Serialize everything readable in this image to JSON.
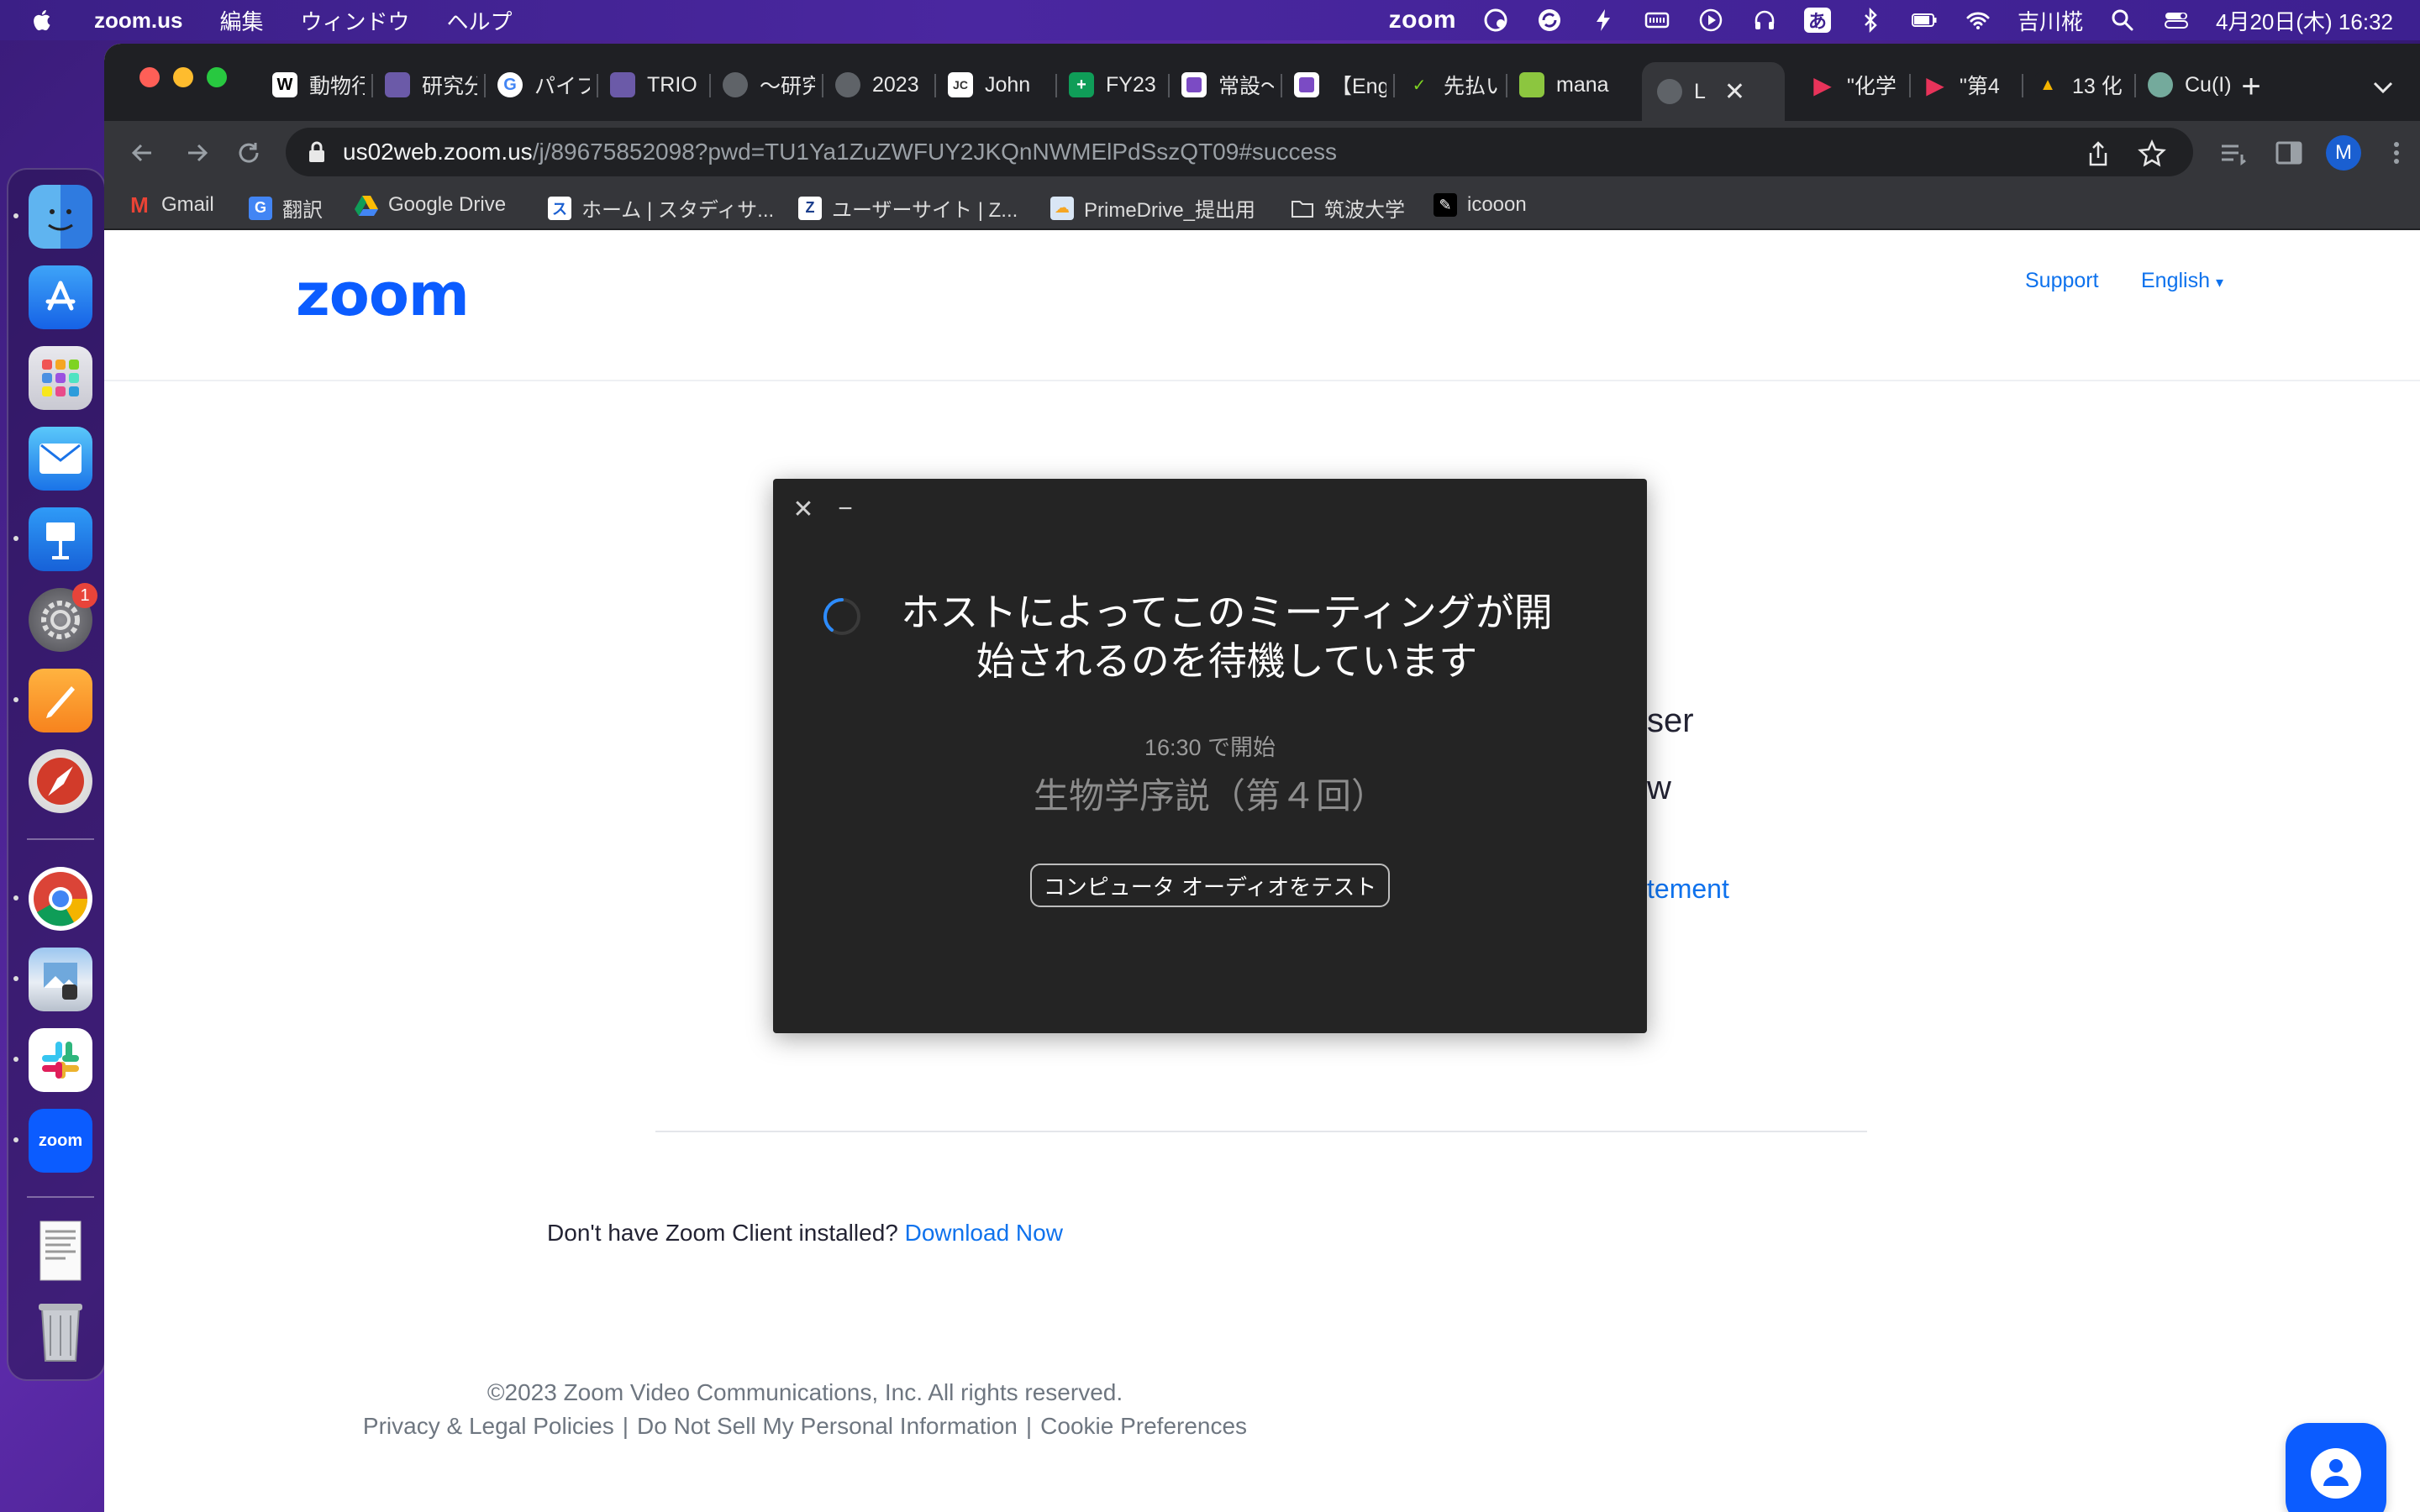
{
  "menubar": {
    "app_name": "zoom.us",
    "items": [
      "編集",
      "ウィンドウ",
      "ヘルプ"
    ],
    "zoom_status": "zoom",
    "ime": "あ",
    "user": "吉川椛",
    "datetime": "4月20日(木) 16:32"
  },
  "dock": {
    "apps": [
      "Finder",
      "App Store",
      "Launchpad",
      "Mail",
      "Keynote",
      "System Settings",
      "Pages",
      "Safari",
      "Chrome",
      "Preview",
      "Slack",
      "zoom",
      "Document",
      "Trash"
    ],
    "zoom_label": "zoom",
    "settings_badge": "1"
  },
  "tabs": [
    {
      "label": "動物行"
    },
    {
      "label": "研究分"
    },
    {
      "label": "パイプ"
    },
    {
      "label": "TRIO"
    },
    {
      "label": "〜研究"
    },
    {
      "label": "2023"
    },
    {
      "label": "John"
    },
    {
      "label": "FY23"
    },
    {
      "label": "常設〜"
    },
    {
      "label": "【Eng"
    },
    {
      "label": "先払い"
    },
    {
      "label": "mana"
    },
    {
      "label": "L"
    },
    {
      "label": "\"化学"
    },
    {
      "label": "\"第4"
    },
    {
      "label": "13 化"
    },
    {
      "label": "Cu(I)"
    }
  ],
  "address": {
    "host": "us02web.zoom.us",
    "path": "/j/89675852098?pwd=TU1Ya1ZuZWFUY2JKQnNWMElPdSszQT09#success"
  },
  "bookmarks": [
    {
      "label": "Gmail"
    },
    {
      "label": "翻訳"
    },
    {
      "label": "Google Drive"
    },
    {
      "label": "ホーム | スタディサ..."
    },
    {
      "label": "ユーザーサイト | Z..."
    },
    {
      "label": "PrimeDrive_提出用"
    },
    {
      "label": "筑波大学"
    },
    {
      "label": "icooon"
    }
  ],
  "page": {
    "logo": "zoom",
    "support": "Support",
    "language": "English",
    "behind_text_1": "ser",
    "behind_text_2": "w",
    "behind_link": "tement",
    "download_prompt": "Don't have Zoom Client installed?",
    "download_link": "Download Now",
    "copyright": "©2023 Zoom Video Communications, Inc. All rights reserved.",
    "footer_links": [
      "Privacy & Legal Policies",
      "Do Not Sell My Personal Information",
      "Cookie Preferences"
    ]
  },
  "dialog": {
    "title": "ホストによってこのミーティングが開始されるのを待機しています",
    "start_time": "16:30 で開始",
    "meeting_name": "生物学序説（第４回）",
    "test_audio_button": "コンピュータ オーディオをテスト"
  },
  "colors": {
    "zoom_blue": "#0b5cff",
    "link_blue": "#0e72ed",
    "dialog_bg": "#242424",
    "browser_dark": "#35363a"
  }
}
